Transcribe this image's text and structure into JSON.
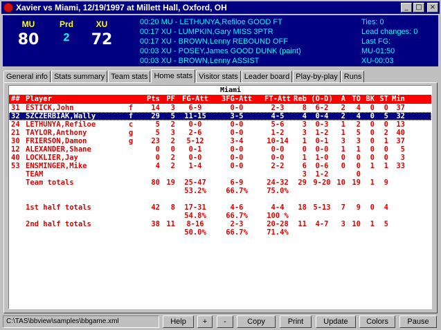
{
  "window": {
    "title": "Xavier vs Miami, 12/19/1997 at Millett Hall, Oxford, OH",
    "controls": [
      "_",
      "□",
      "×"
    ]
  },
  "scoreboard": {
    "home_abbr": "MU",
    "home_score": "80",
    "period_label": "Prd",
    "period": "2",
    "visitor_abbr": "XU",
    "visitor_score": "72",
    "plays": [
      "00:20 MU - LETHUNYA,Refiloe GOOD FT",
      "00:17 XU - LUMPKIN,Gary MISS 3PTR",
      "00:17 XU - BROWN,Lenny REBOUND OFF",
      "00:03 XU - POSEY,James GOOD DUNK (paint)",
      "00:03 XU - BROWN,Lenny ASSIST"
    ],
    "stats": [
      "Ties: 0",
      "Lead changes: 0",
      "Last FG:",
      "MU-01:50",
      "XU-00:03"
    ]
  },
  "tabs": [
    {
      "label": "General info",
      "active": false
    },
    {
      "label": "Stats summary",
      "active": false
    },
    {
      "label": "Team stats",
      "active": false
    },
    {
      "label": "Home stats",
      "active": true
    },
    {
      "label": "Visitor stats",
      "active": false
    },
    {
      "label": "Leader board",
      "active": false
    },
    {
      "label": "Play-by-play",
      "active": false
    },
    {
      "label": "Runs",
      "active": false
    }
  ],
  "boxscore": {
    "team_name": "Miami",
    "headers": {
      "num": "##",
      "name": "Player",
      "pts": "Pts",
      "pf": "PF",
      "fg": "FG-Att",
      "fg3": "3FG-Att",
      "ft": "FT-Att",
      "reb": "Reb",
      "od": "(O-D)",
      "a": "A",
      "to": "TO",
      "bk": "BK",
      "st": "ST",
      "min": "Min"
    },
    "players": [
      {
        "num": "31",
        "name": "ESTICK,John",
        "pos": "f",
        "pts": "14",
        "pf": "3",
        "fg": "6-9",
        "fg3": "0-0",
        "ft": "2-3",
        "reb": "8",
        "od": "6-2",
        "a": "2",
        "to": "4",
        "bk": "0",
        "st": "0",
        "min": "37",
        "selected": false
      },
      {
        "num": "32",
        "name": "SZCZERBIAK,Wally",
        "pos": "f",
        "pts": "29",
        "pf": "5",
        "fg": "11-15",
        "fg3": "3-5",
        "ft": "4-5",
        "reb": "4",
        "od": "0-4",
        "a": "2",
        "to": "4",
        "bk": "0",
        "st": "5",
        "min": "32",
        "selected": true
      },
      {
        "num": "24",
        "name": "LETHUNYA,Refiloe",
        "pos": "c",
        "pts": "5",
        "pf": "2",
        "fg": "0-0",
        "fg3": "0-0",
        "ft": "5-6",
        "reb": "3",
        "od": "0-3",
        "a": "1",
        "to": "2",
        "bk": "0",
        "st": "0",
        "min": "13",
        "selected": false
      },
      {
        "num": "21",
        "name": "TAYLOR,Anthony",
        "pos": "g",
        "pts": "5",
        "pf": "3",
        "fg": "2-6",
        "fg3": "0-0",
        "ft": "1-2",
        "reb": "3",
        "od": "1-2",
        "a": "1",
        "to": "5",
        "bk": "0",
        "st": "2",
        "min": "40",
        "selected": false
      },
      {
        "num": "30",
        "name": "FRIERSON,Damon",
        "pos": "g",
        "pts": "23",
        "pf": "2",
        "fg": "5-12",
        "fg3": "3-4",
        "ft": "10-14",
        "reb": "1",
        "od": "0-1",
        "a": "3",
        "to": "3",
        "bk": "0",
        "st": "1",
        "min": "37",
        "selected": false
      },
      {
        "num": "12",
        "name": "ALEXANDER,Shane",
        "pos": "",
        "pts": "0",
        "pf": "0",
        "fg": "0-1",
        "fg3": "0-0",
        "ft": "0-0",
        "reb": "0",
        "od": "0-0",
        "a": "1",
        "to": "1",
        "bk": "0",
        "st": "0",
        "min": "5",
        "selected": false
      },
      {
        "num": "40",
        "name": "LOCKLIER,Jay",
        "pos": "",
        "pts": "0",
        "pf": "2",
        "fg": "0-0",
        "fg3": "0-0",
        "ft": "0-0",
        "reb": "1",
        "od": "1-0",
        "a": "0",
        "to": "0",
        "bk": "0",
        "st": "0",
        "min": "3",
        "selected": false
      },
      {
        "num": "53",
        "name": "ENSMINGER,Mike",
        "pos": "",
        "pts": "4",
        "pf": "2",
        "fg": "1-4",
        "fg3": "0-0",
        "ft": "2-2",
        "reb": "6",
        "od": "0-6",
        "a": "0",
        "to": "0",
        "bk": "1",
        "st": "1",
        "min": "33",
        "selected": false
      },
      {
        "num": "",
        "name": "TEAM",
        "pos": "",
        "pts": "",
        "pf": "",
        "fg": "",
        "fg3": "",
        "ft": "",
        "reb": "3",
        "od": "1-2",
        "a": "",
        "to": "0",
        "bk": "",
        "st": "",
        "min": "",
        "selected": false
      }
    ],
    "team_totals": {
      "label": "Team totals",
      "pts": "80",
      "pf": "19",
      "fg": "25-47",
      "fg3": "6-9",
      "ft": "24-32",
      "reb": "29",
      "od": "9-20",
      "a": "10",
      "to": "19",
      "bk": "1",
      "st": "9",
      "fg_pct": "53.2%",
      "fg3_pct": "66.7%",
      "ft_pct": "75.0%"
    },
    "first_half": {
      "label": "1st half totals",
      "pts": "42",
      "pf": "8",
      "fg": "17-31",
      "fg3": "4-6",
      "ft": "4-4",
      "reb": "18",
      "od": "5-13",
      "a": "7",
      "to": "9",
      "bk": "0",
      "st": "4",
      "fg_pct": "54.8%",
      "fg3_pct": "66.7%",
      "ft_pct": "100 %"
    },
    "second_half": {
      "label": "2nd half totals",
      "pts": "38",
      "pf": "11",
      "fg": "8-16",
      "fg3": "2-3",
      "ft": "20-28",
      "reb": "11",
      "od": "4-7",
      "a": "3",
      "to": "10",
      "bk": "1",
      "st": "5",
      "fg_pct": "50.0%",
      "fg3_pct": "66.7%",
      "ft_pct": "71.4%"
    }
  },
  "footer": {
    "path": "C:\\TAS\\bbview\\samples\\bbgame.xml",
    "buttons": [
      "Help",
      "+",
      "-",
      "Copy",
      "Print",
      "Update",
      "Colors",
      "Pause"
    ]
  }
}
